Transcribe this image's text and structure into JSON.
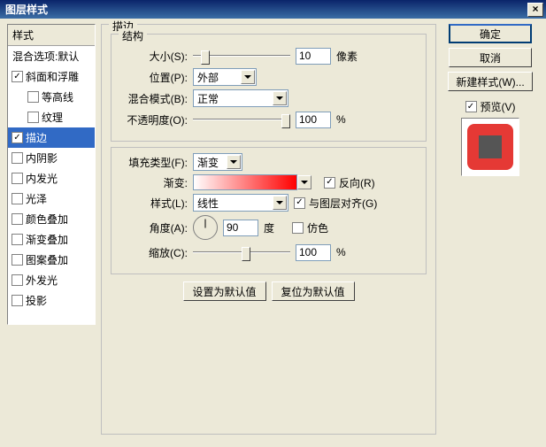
{
  "title": "图层样式",
  "left": {
    "header": "样式",
    "blend_options": "混合选项:默认",
    "items": [
      {
        "label": "斜面和浮雕",
        "checked": true,
        "indent": 0
      },
      {
        "label": "等高线",
        "checked": false,
        "indent": 1
      },
      {
        "label": "纹理",
        "checked": false,
        "indent": 1
      },
      {
        "label": "描边",
        "checked": true,
        "indent": 0,
        "selected": true
      },
      {
        "label": "内阴影",
        "checked": false,
        "indent": 0
      },
      {
        "label": "内发光",
        "checked": false,
        "indent": 0
      },
      {
        "label": "光泽",
        "checked": false,
        "indent": 0
      },
      {
        "label": "颜色叠加",
        "checked": false,
        "indent": 0
      },
      {
        "label": "渐变叠加",
        "checked": false,
        "indent": 0
      },
      {
        "label": "图案叠加",
        "checked": false,
        "indent": 0
      },
      {
        "label": "外发光",
        "checked": false,
        "indent": 0
      },
      {
        "label": "投影",
        "checked": false,
        "indent": 0
      }
    ]
  },
  "stroke": {
    "panel_title": "描边",
    "structure_title": "结构",
    "size_label": "大小(S):",
    "size_value": "10",
    "size_unit": "像素",
    "size_pct": 8,
    "position_label": "位置(P):",
    "position_value": "外部",
    "blend_label": "混合模式(B):",
    "blend_value": "正常",
    "opacity_label": "不透明度(O):",
    "opacity_value": "100",
    "opacity_unit": "%",
    "opacity_pct": 100,
    "filltype_label": "填充类型(F):",
    "filltype_value": "渐变",
    "gradient_label": "渐变:",
    "reverse_label": "反向(R)",
    "reverse_checked": true,
    "style_label": "样式(L):",
    "style_value": "线性",
    "align_label": "与图层对齐(G)",
    "align_checked": true,
    "angle_label": "角度(A):",
    "angle_value": "90",
    "angle_unit": "度",
    "dither_label": "仿色",
    "dither_checked": false,
    "scale_label": "缩放(C):",
    "scale_value": "100",
    "scale_unit": "%",
    "scale_pct": 50,
    "make_default": "设置为默认值",
    "reset_default": "复位为默认值"
  },
  "right": {
    "ok": "确定",
    "cancel": "取消",
    "new_style": "新建样式(W)...",
    "preview_label": "预览(V)",
    "preview_checked": true
  }
}
